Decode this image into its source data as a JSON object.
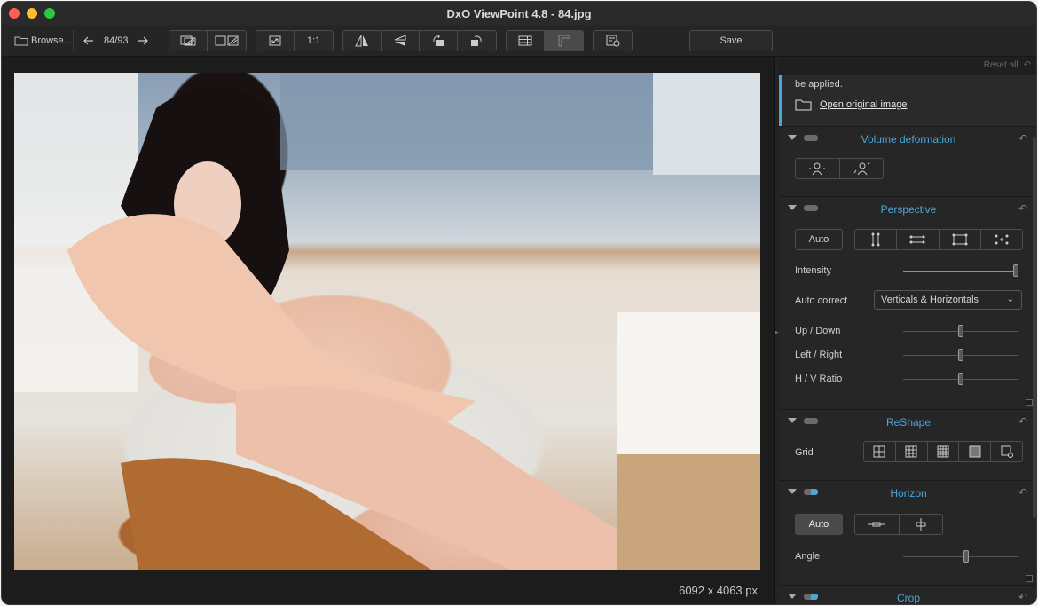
{
  "window": {
    "title": "DxO ViewPoint 4.8 - 84.jpg"
  },
  "toolbar": {
    "browse_label": "Browse...",
    "counter": "84/93",
    "one_to_one": "1:1",
    "save_label": "Save"
  },
  "viewer": {
    "image_size": "6092 x 4063 px"
  },
  "panel": {
    "reset_all": "Reset all",
    "info_text": "be applied.",
    "open_original": "Open original image",
    "volume": {
      "title": "Volume deformation"
    },
    "perspective": {
      "title": "Perspective",
      "auto_label": "Auto",
      "intensity_label": "Intensity",
      "intensity_value": 1.0,
      "auto_correct_label": "Auto correct",
      "auto_correct_value": "Verticals & Horizontals",
      "updown_label": "Up / Down",
      "leftright_label": "Left / Right",
      "hvratio_label": "H / V Ratio",
      "updown_value": 0.5,
      "leftright_value": 0.5,
      "hvratio_value": 0.5
    },
    "reshape": {
      "title": "ReShape",
      "grid_label": "Grid"
    },
    "horizon": {
      "title": "Horizon",
      "auto_label": "Auto",
      "angle_label": "Angle",
      "angle_value": 0.55
    },
    "crop": {
      "title": "Crop"
    }
  },
  "colors": {
    "accent": "#4ca6d8"
  }
}
